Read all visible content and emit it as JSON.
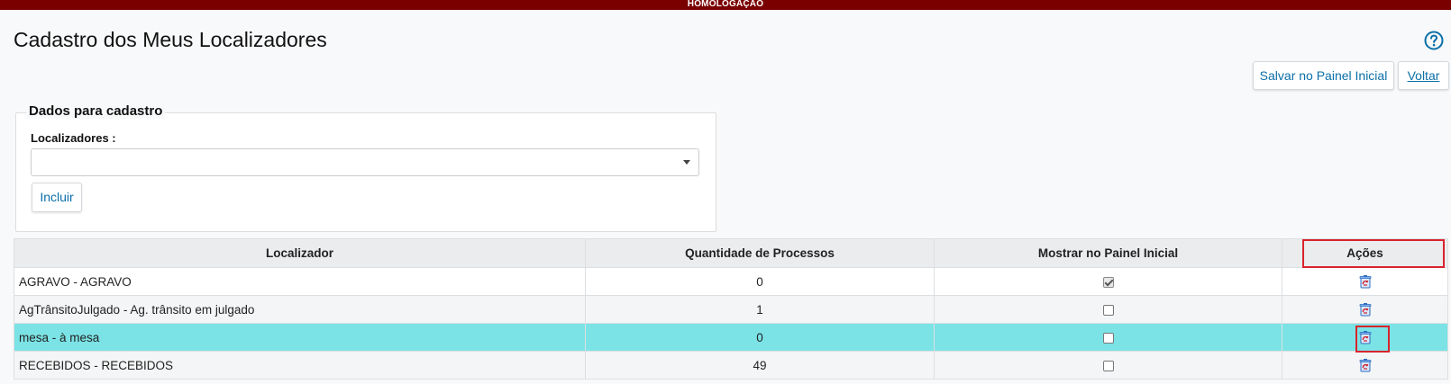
{
  "environment_banner": "HOMOLOGAÇÃO",
  "page_title": "Cadastro dos Meus Localizadores",
  "header_buttons": {
    "save_label": "Salvar no Painel Inicial",
    "back_label": "Voltar"
  },
  "form": {
    "legend": "Dados para cadastro",
    "localizadores_label": "Localizadores :",
    "localizadores_value": "",
    "include_label": "Incluir"
  },
  "table": {
    "columns": [
      "Localizador",
      "Quantidade de Processos",
      "Mostrar no Painel Inicial",
      "Ações"
    ],
    "rows": [
      {
        "localizador": "AGRAVO - AGRAVO",
        "quantidade": "0",
        "mostrar": true,
        "selected": false
      },
      {
        "localizador": "AgTrânsitoJulgado - Ag. trânsito em julgado",
        "quantidade": "1",
        "mostrar": false,
        "selected": false
      },
      {
        "localizador": "mesa - à mesa",
        "quantidade": "0",
        "mostrar": false,
        "selected": true
      },
      {
        "localizador": "RECEBIDOS - RECEBIDOS",
        "quantidade": "49",
        "mostrar": false,
        "selected": false
      }
    ]
  },
  "icons": {
    "help": "help-icon",
    "delete": "trash-icon",
    "dropdown": "chevron-down-icon"
  },
  "colors": {
    "banner": "#7a0000",
    "link": "#0a6fa8",
    "selected_row": "#7be3e5",
    "highlight": "#d9232d"
  }
}
